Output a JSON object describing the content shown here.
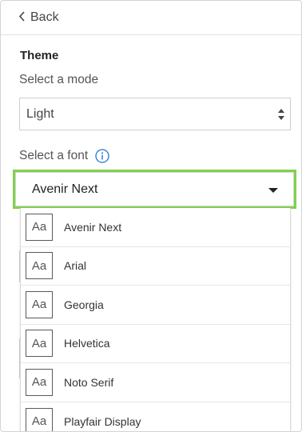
{
  "header": {
    "back_label": "Back"
  },
  "theme": {
    "title": "Theme",
    "mode_label": "Select a mode",
    "mode_value": "Light",
    "font_label": "Select a font",
    "font_value": "Avenir Next"
  },
  "font_options": [
    {
      "preview": "Aa",
      "name": "Avenir Next"
    },
    {
      "preview": "Aa",
      "name": "Arial"
    },
    {
      "preview": "Aa",
      "name": "Georgia"
    },
    {
      "preview": "Aa",
      "name": "Helvetica"
    },
    {
      "preview": "Aa",
      "name": "Noto Serif"
    },
    {
      "preview": "Aa",
      "name": "Playfair Display"
    }
  ],
  "icons": {
    "back": "chevron-left-icon",
    "select_arrows": "sort-arrows-icon",
    "info": "info-circle-icon",
    "dropdown_caret": "caret-down-icon"
  },
  "colors": {
    "focus_outline": "#81d14e",
    "info_icon": "#1f77d0",
    "text": "#333333"
  }
}
